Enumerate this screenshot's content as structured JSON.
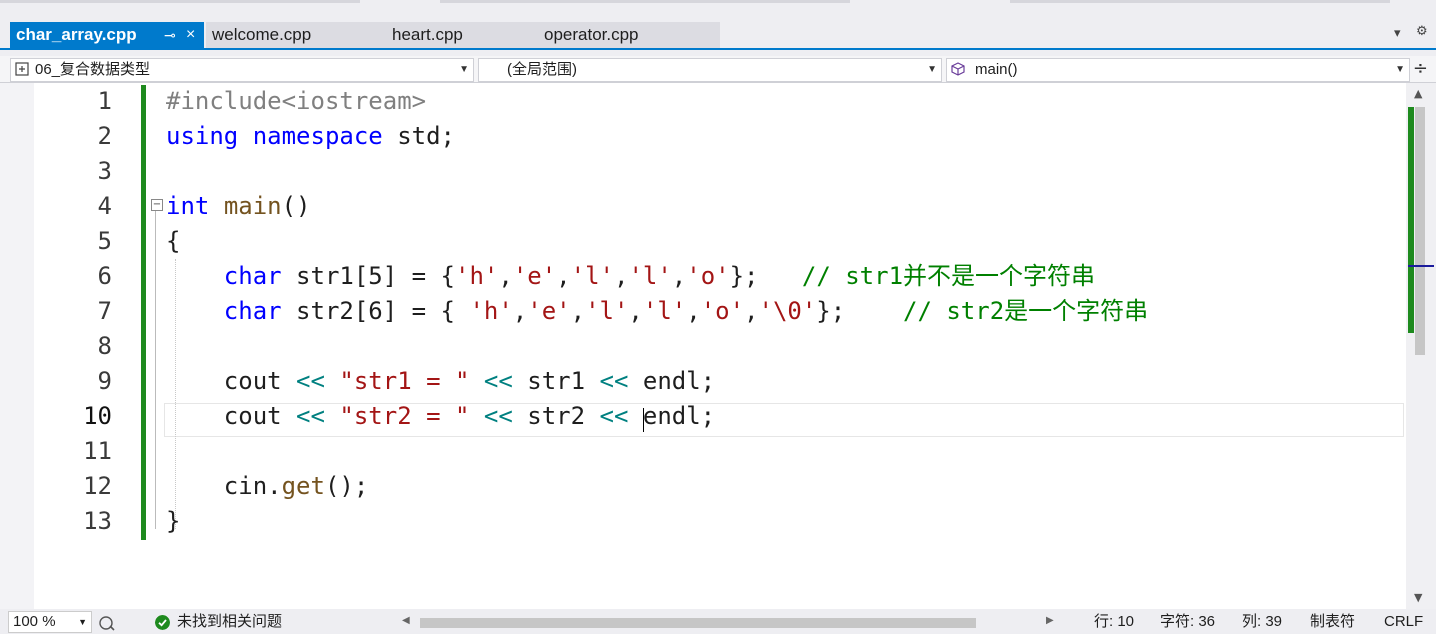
{
  "tabs": [
    {
      "label": "char_array.cpp",
      "active": true
    },
    {
      "label": "welcome.cpp",
      "active": false
    },
    {
      "label": "heart.cpp",
      "active": false
    },
    {
      "label": "operator.cpp",
      "active": false
    }
  ],
  "tab_controls": {
    "pin": "⊸",
    "close": "×",
    "dropdown": "▾",
    "settings": "⚙"
  },
  "navbar": {
    "project": "06_复合数据类型",
    "scope": "(全局范围)",
    "member": "main()",
    "split": "÷"
  },
  "editor": {
    "current_line": 10,
    "line_numbers": [
      "1",
      "2",
      "3",
      "4",
      "5",
      "6",
      "7",
      "8",
      "9",
      "10",
      "11",
      "12",
      "13"
    ],
    "lines": {
      "l1": {
        "pp": "#include<iostream>"
      },
      "l2": {
        "kw1": "using",
        "kw2": "namespace",
        "rest": "std;"
      },
      "l4": {
        "kw": "int",
        "fn": "main",
        "rest": "()"
      },
      "l5": {
        "text": "{"
      },
      "l6": {
        "kw": "char",
        "a": "str1[5] = {",
        "s1": "'h'",
        "s2": "'e'",
        "s3": "'l'",
        "s4": "'l'",
        "s5": "'o'",
        "b": "};",
        "comment": "// str1并不是一个字符串"
      },
      "l7": {
        "kw": "char",
        "a": "str2[6] = { ",
        "s1": "'h'",
        "s2": "'e'",
        "s3": "'l'",
        "s4": "'l'",
        "s5": "'o'",
        "s6": "'\\0'",
        "b": "};",
        "comment": "// str2是一个字符串"
      },
      "l9": {
        "a": "cout",
        "op1": "<<",
        "str": "\"str1 = \"",
        "op2": "<<",
        "b": "str1",
        "op3": "<<",
        "c": "endl;"
      },
      "l10": {
        "a": "cout",
        "op1": "<<",
        "str": "\"str2 = \"",
        "op2": "<<",
        "b": "str2",
        "op3": "<<",
        "c": "endl;"
      },
      "l12": {
        "a": "cin.",
        "fn": "get",
        "b": "();"
      },
      "l13": {
        "text": "}"
      }
    },
    "colors": {
      "keyword": "#0000ff",
      "string": "#a31515",
      "comment": "#008000",
      "change_bar": "#1e8a1e",
      "accent": "#007acc"
    }
  },
  "statusbar": {
    "zoom": "100 %",
    "issues": "未找到相关问题",
    "line": "行: 10",
    "char": "字符: 36",
    "col": "列: 39",
    "tabs": "制表符",
    "eol": "CRLF"
  }
}
